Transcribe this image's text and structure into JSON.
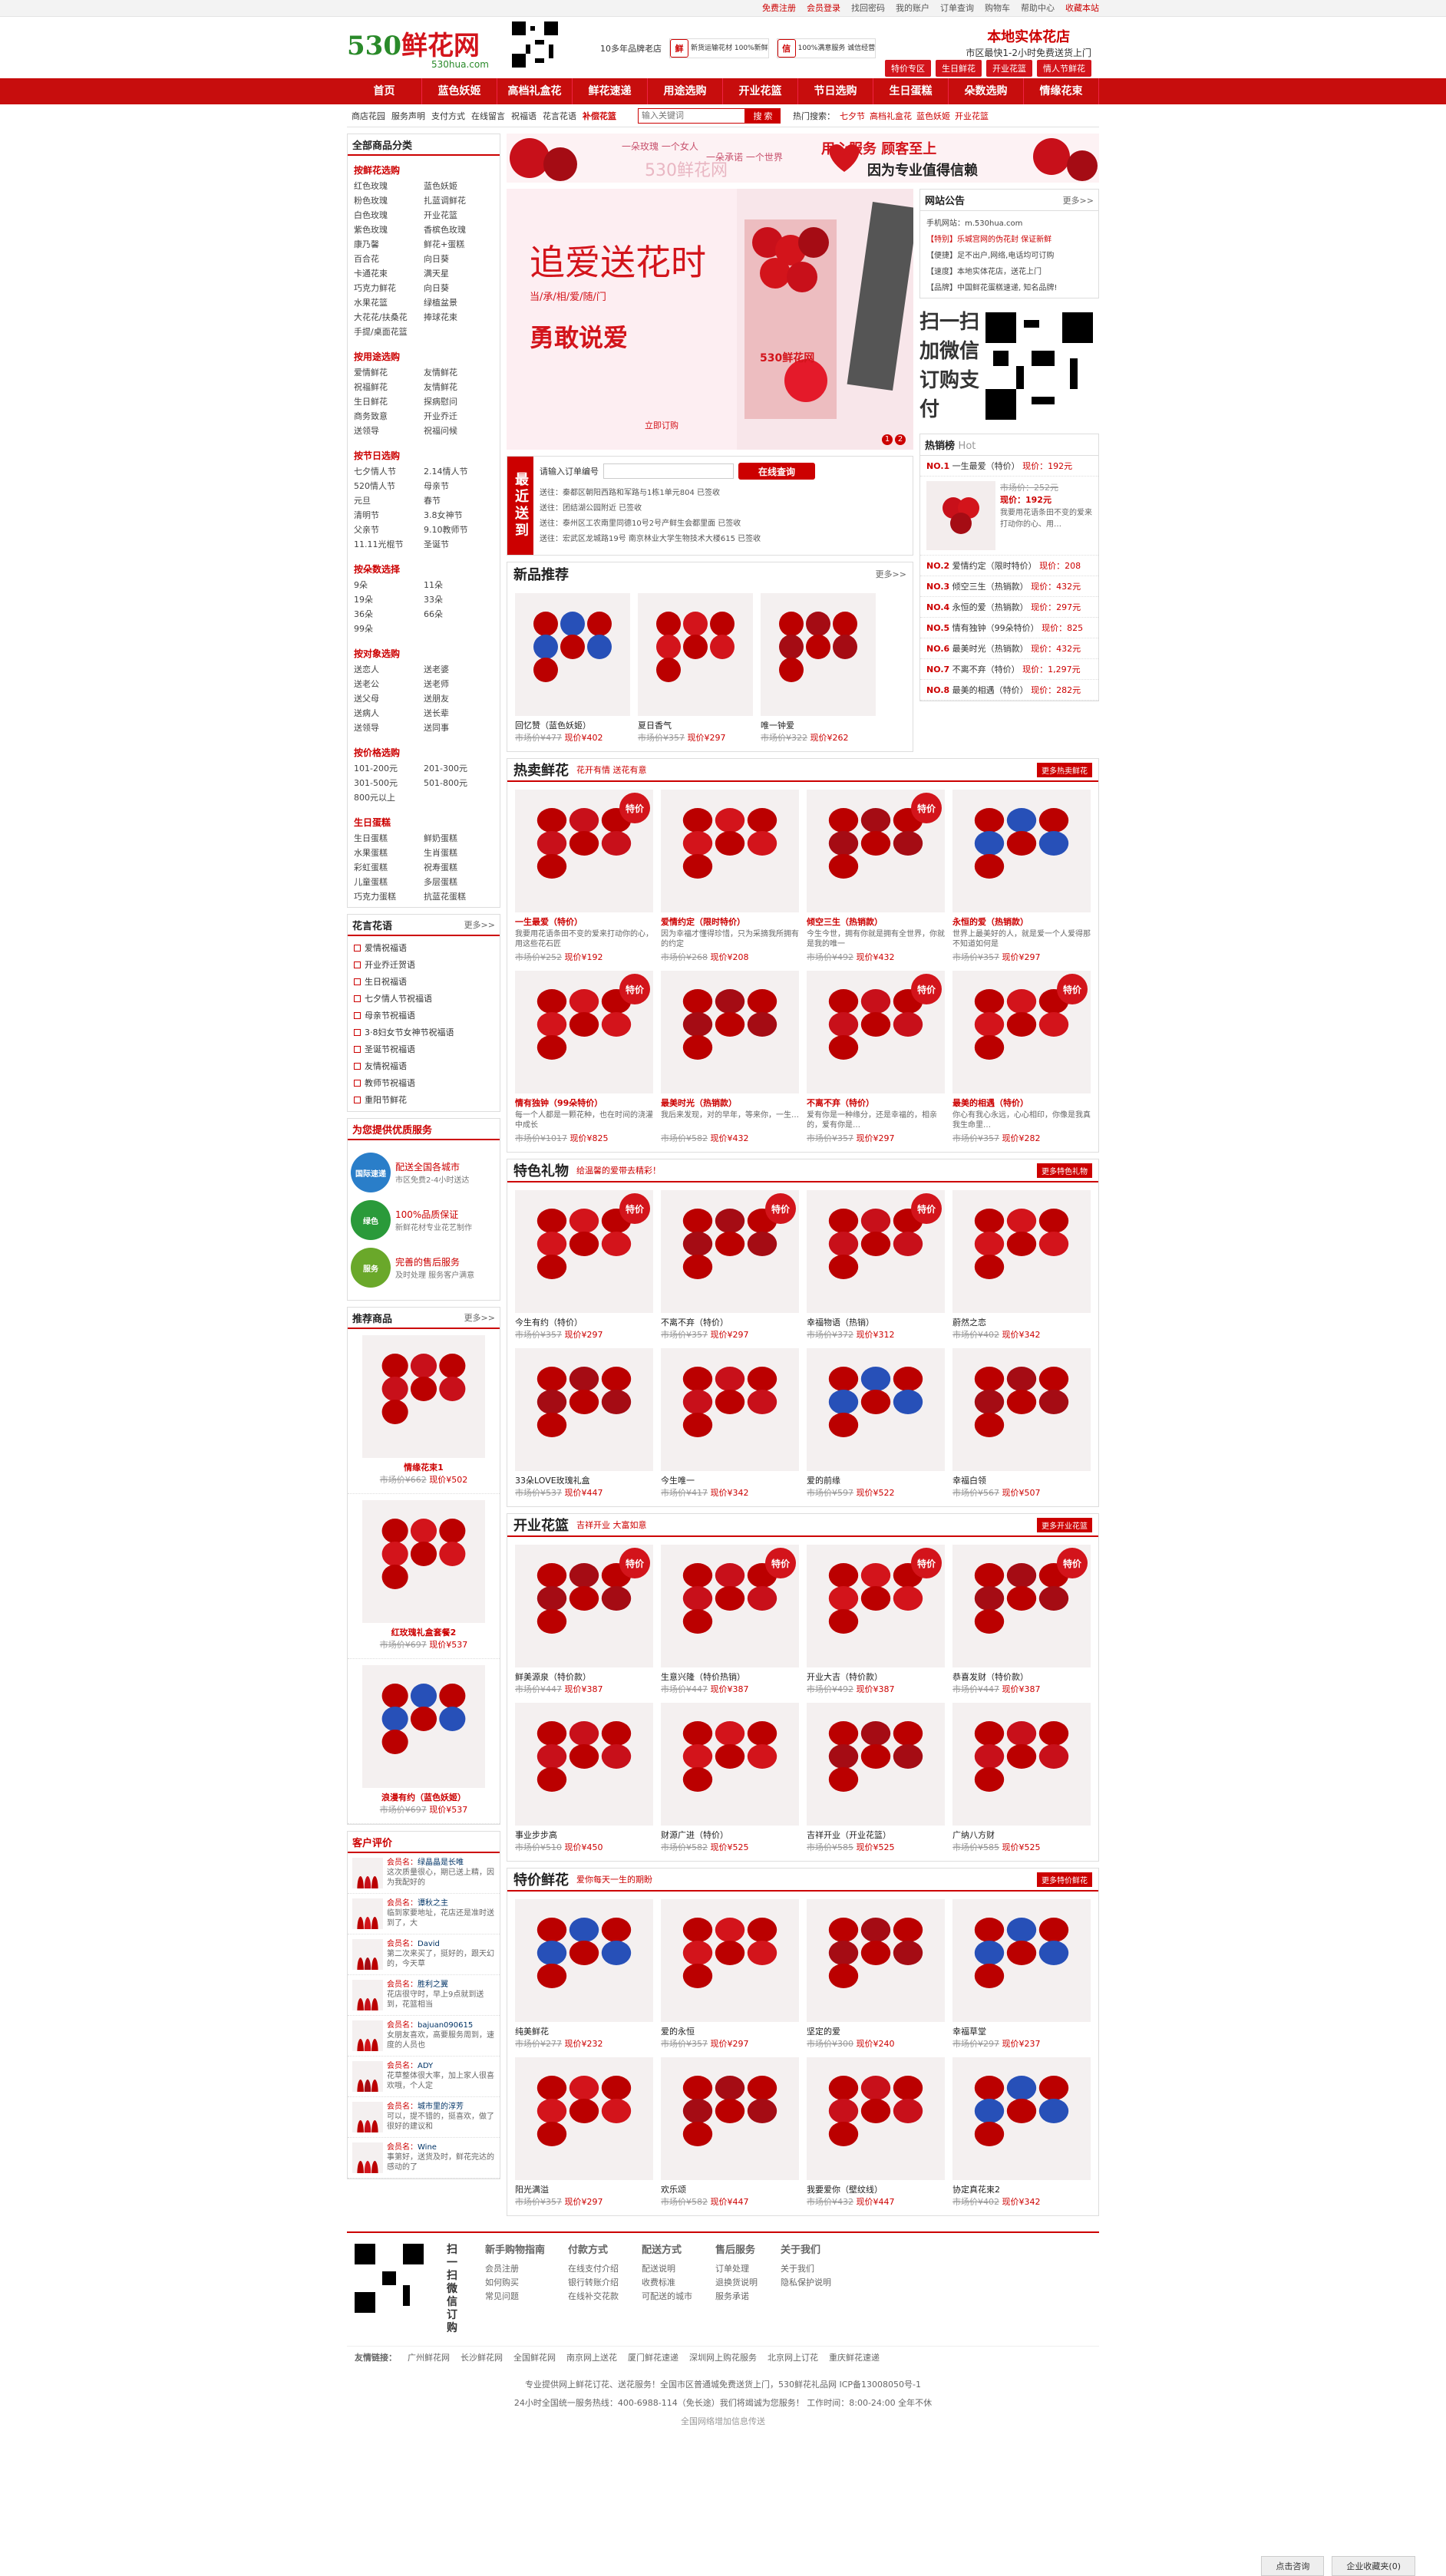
{
  "topbar": {
    "links": [
      "免费注册",
      "会员登录",
      "找回密码",
      "我的账户",
      "订单查询",
      "购物车",
      "帮助中心",
      "收藏本站"
    ]
  },
  "logo": {
    "name_green": "530",
    "name_red": "鲜花网",
    "domain": "530hua.com"
  },
  "header": {
    "promise1": "10多年品牌老店",
    "badge1": "鲜",
    "badge1_text": "新货运输花材 100%新鲜",
    "badge2": "信",
    "badge2_text": "100%满意服务 诚信经营",
    "store_title": "本地实体花店",
    "store_sub": "市区最快1-2小时免费送货上门",
    "btns": [
      "特价专区",
      "生日鲜花",
      "开业花篮",
      "情人节鲜花"
    ]
  },
  "nav": [
    "首页",
    "蓝色妖姬",
    "高档礼盒花",
    "鲜花速递",
    "用途选购",
    "开业花篮",
    "节日选购",
    "生日蛋糕",
    "朵数选购",
    "情缘花束"
  ],
  "subnav": {
    "links": [
      "商店花园",
      "服务声明",
      "支付方式",
      "在线留言",
      "祝福语",
      "花言花语"
    ],
    "special": "补偿花篮",
    "search_placeholder": "输入关键词",
    "search_btn": "搜 索",
    "hot_label": "热门搜索：",
    "hot": [
      "七夕节",
      "高档礼盒花",
      "蓝色妖姬",
      "开业花篮"
    ]
  },
  "cats": {
    "title": "全部商品分类",
    "s1": {
      "t": "按鲜花选购",
      "items": [
        "红色玫瑰",
        "蓝色妖姬",
        "粉色玫瑰",
        "扎蓝调鲜花",
        "白色玫瑰",
        "开业花篮",
        "紫色玫瑰",
        "香槟色玫瑰",
        "康乃馨",
        "鲜花+蛋糕",
        "百合花",
        "向日葵",
        "卡通花束",
        "满天星",
        "巧克力鲜花",
        "向日葵",
        "水果花篮",
        "绿植盆景",
        "大花花/扶桑花",
        "捧球花束",
        "手提/桌面花篮"
      ]
    },
    "s2": {
      "t": "按用途选购",
      "items": [
        "爱情鲜花",
        "友情鲜花",
        "祝福鲜花",
        "友情鲜花",
        "生日鲜花",
        "探病慰问",
        "商务致意",
        "开业乔迁",
        "送领导",
        "祝福问候"
      ]
    },
    "s3": {
      "t": "按节日选购",
      "items": [
        "七夕情人节",
        "2.14情人节",
        "520情人节",
        "母亲节",
        "元旦",
        "春节",
        "清明节",
        "3.8女神节",
        "父亲节",
        "9.10教师节",
        "11.11光棍节",
        "圣诞节"
      ]
    },
    "s4": {
      "t": "按朵数选择",
      "items": [
        "9朵",
        "11朵",
        "19朵",
        "33朵",
        "36朵",
        "66朵",
        "99朵"
      ]
    },
    "s5": {
      "t": "按对象选购",
      "items": [
        "送恋人",
        "送老婆",
        "送老公",
        "送老师",
        "送父母",
        "送朋友",
        "送病人",
        "送长辈",
        "送领导",
        "送同事"
      ]
    },
    "s6": {
      "t": "按价格选购",
      "items": [
        "101-200元",
        "201-300元",
        "301-500元",
        "501-800元",
        "800元以上"
      ]
    },
    "s7": {
      "t": "生日蛋糕",
      "items": [
        "生日蛋糕",
        "鲜奶蛋糕",
        "水果蛋糕",
        "生肖蛋糕",
        "彩虹蛋糕",
        "祝寿蛋糕",
        "儿童蛋糕",
        "多层蛋糕",
        "巧克力蛋糕",
        "抗蓝花蛋糕"
      ]
    }
  },
  "flowerlang": {
    "title": "花言花语",
    "more": "更多>>",
    "items": [
      "爱情祝福语",
      "开业乔迁贺语",
      "生日祝福语",
      "七夕情人节祝福语",
      "母亲节祝福语",
      "3·8妇女节女神节祝福语",
      "圣诞节祝福语",
      "友情祝福语",
      "教师节祝福语",
      "重阳节鲜花"
    ]
  },
  "service": {
    "title": "为您提供优质服务",
    "rows": [
      {
        "icon": "国际速递",
        "a": "配送全国各城市",
        "b": "市区免费2-4小时送达"
      },
      {
        "icon": "绿色",
        "a": "100%品质保证",
        "b": "新鲜花材专业花艺制作"
      },
      {
        "icon": "服务",
        "a": "完善的售后服务",
        "b": "及时处理 服务客户满意"
      }
    ]
  },
  "recommend": {
    "title": "推荐商品",
    "more": "更多>>",
    "items": [
      {
        "name": "情缘花束1",
        "old": "市场价¥662",
        "now": "现价¥502"
      },
      {
        "name": "红玫瑰礼盒套餐2",
        "old": "市场价¥697",
        "now": "现价¥537"
      },
      {
        "name": "浪漫有约（蓝色妖姬）",
        "old": "市场价¥697",
        "now": "现价¥537"
      }
    ]
  },
  "reviews": {
    "title": "客户评价",
    "items": [
      {
        "u": "会员名：",
        "n": "绿晶晶是长唯",
        "t": "这次质量很心，期已送上精，因为我配好的"
      },
      {
        "u": "会员名：",
        "n": "谭秋之主",
        "t": "临到家要地址，花店还是准时送到了，大"
      },
      {
        "u": "会员名：",
        "n": "David",
        "t": "第二次来买了，挺好的，跟天幻的，今天草"
      },
      {
        "u": "会员名：",
        "n": "胜利之翼",
        "t": "花店很守时，早上9点就到送到，花篮相当"
      },
      {
        "u": "会员名：",
        "n": "bajuan090615",
        "t": "女朋友喜欢，高要服务周到，速度的人员也"
      },
      {
        "u": "会员名：",
        "n": "ADY",
        "t": "花草整体很大率，加上家人很喜欢哦，个人定"
      },
      {
        "u": "会员名：",
        "n": "城市里的淳芳",
        "t": "可以，提不错的，挺喜欢，做了很好的建议和"
      },
      {
        "u": "会员名：",
        "n": "Wine",
        "t": "事第好，送货及时，鲜花完达的感动的了"
      }
    ]
  },
  "banner": {
    "t1": "一朵玫瑰 一个女人",
    "t2": "一朵承诺 一个世界",
    "brand": "530鲜花网",
    "slogan1": "用心服务 顾客至上",
    "slogan2": "因为专业值得信赖"
  },
  "slide": {
    "t1": "追爱送花时",
    "t2": "当/承/相/爱/随/门",
    "t3": "勇敢说爱",
    "brand": "530鲜花网",
    "btn": "立即订购",
    "dots": [
      "1",
      "2"
    ]
  },
  "notice": {
    "title": "网站公告",
    "more": "更多>>",
    "items": [
      "手机网站：m.530hua.com",
      "【特别】乐城宫网的伪花封 保证新鲜",
      "【便捷】足不出户,网络,电话均可订购",
      "【速度】本地实体花店，送花上门",
      "【品牌】中国鲜花蛋糕速递, 知名品牌!"
    ]
  },
  "wechat": {
    "t": "扫一扫 加微信 订购支付"
  },
  "query": {
    "label": "最近送到",
    "input_label": "请输入订单编号",
    "btn": "在线查询",
    "logs": [
      "送往：秦都区朝阳西路和军路与1栋1单元804 已签收",
      "送往：团结湖公园附近 已签收",
      "送往：泰州区工农南里同德10号2号产鲜生会都里面 已签收",
      "送往：宏武区龙城路19号 南京林业大学生物技术大楼615 已签收"
    ]
  },
  "ranking": {
    "title": "热销榜",
    "sub": "Hot",
    "first": {
      "no": "NO.1",
      "name": "一生最爱（特价）",
      "price": "现价：192元",
      "old": "市场价：252元",
      "now": "现价：192元",
      "desc": "我要用花语条田不变的爱来打动你的心、用…"
    },
    "items": [
      {
        "no": "NO.2",
        "name": "爱情约定（限时特价）",
        "price": "现价：208"
      },
      {
        "no": "NO.3",
        "name": "倾空三生（热销款）",
        "price": "现价：432元"
      },
      {
        "no": "NO.4",
        "name": "永恒的爱（热销款）",
        "price": "现价：297元"
      },
      {
        "no": "NO.5",
        "name": "情有独钟（99朵特价）",
        "price": "现价：825"
      },
      {
        "no": "NO.6",
        "name": "最美时光（热销款）",
        "price": "现价：432元"
      },
      {
        "no": "NO.7",
        "name": "不离不弃（特价）",
        "price": "现价：1,297元"
      },
      {
        "no": "NO.8",
        "name": "最美的相遇（特价）",
        "price": "现价：282元"
      }
    ]
  },
  "newproducts": {
    "title": "新品推荐",
    "more": "更多>>",
    "items": [
      {
        "name": "回忆赞（蓝色妖姬）",
        "old": "市场价¥477",
        "now": "现价¥402"
      },
      {
        "name": "夏日香气",
        "old": "市场价¥357",
        "now": "现价¥297"
      },
      {
        "name": "唯一钟爱",
        "old": "市场价¥322",
        "now": "现价¥262"
      }
    ]
  },
  "hot": {
    "title": "热卖鲜花",
    "sub": "花开有情 送花有意",
    "more": "更多热卖鲜花",
    "items": [
      {
        "name": "一生最爱（特价）",
        "desc": "我要用花语条田不变的爱来打动你的心，用这些花石匠",
        "old": "市场价¥252",
        "now": "现价¥192",
        "tag": "特价"
      },
      {
        "name": "爱情约定（限时特价）",
        "desc": "因为幸福才懂得珍惜，只为采摘我所拥有的约定",
        "old": "市场价¥268",
        "now": "现价¥208",
        "tag": ""
      },
      {
        "name": "倾空三生（热销款）",
        "desc": "今生今世，拥有你就是拥有全世界，你就是我的唯一",
        "old": "市场价¥492",
        "now": "现价¥432",
        "tag": "特价"
      },
      {
        "name": "永恒的爱（热销款）",
        "desc": "世界上最美好的人，就是爱一个人爱得那不知道如何是",
        "old": "市场价¥357",
        "now": "现价¥297",
        "tag": ""
      },
      {
        "name": "情有独钟（99朵特价）",
        "desc": "每一个人都是一颗花种，也在时间的浇灌中成长",
        "old": "市场价¥1017",
        "now": "现价¥825",
        "tag": "特价"
      },
      {
        "name": "最美时光（热销款）",
        "desc": "我后来发现，对的早年，等来你，一生…",
        "old": "市场价¥582",
        "now": "现价¥432",
        "tag": ""
      },
      {
        "name": "不离不弃（特价）",
        "desc": "爱有你是一种缘分，还是幸福的，相亲的，爱有你是…",
        "old": "市场价¥357",
        "now": "现价¥297",
        "tag": "特价"
      },
      {
        "name": "最美的相遇（特价）",
        "desc": "你心有我心永远，心心相印，你像是我真我生命里…",
        "old": "市场价¥357",
        "now": "现价¥282",
        "tag": "特价"
      }
    ]
  },
  "gift": {
    "title": "特色礼物",
    "sub": "给温馨的爱带去精彩！",
    "more": "更多特色礼物",
    "items": [
      {
        "name": "今生有约（特价）",
        "old": "市场价¥357",
        "now": "现价¥297",
        "tag": "特价"
      },
      {
        "name": "不离不弃（特价）",
        "old": "市场价¥357",
        "now": "现价¥297",
        "tag": "特价"
      },
      {
        "name": "幸福物语（热销）",
        "old": "市场价¥372",
        "now": "现价¥312",
        "tag": "特价"
      },
      {
        "name": "蔚然之恋",
        "old": "市场价¥402",
        "now": "现价¥342",
        "tag": ""
      },
      {
        "name": "33朵LOVE玫瑰礼盒",
        "old": "市场价¥537",
        "now": "现价¥447",
        "tag": ""
      },
      {
        "name": "今生唯一",
        "old": "市场价¥417",
        "now": "现价¥342",
        "tag": ""
      },
      {
        "name": "爱的前缘",
        "old": "市场价¥597",
        "now": "现价¥522",
        "tag": ""
      },
      {
        "name": "幸福白领",
        "old": "市场价¥567",
        "now": "现价¥507",
        "tag": ""
      }
    ]
  },
  "basket": {
    "title": "开业花篮",
    "sub": "吉祥开业 大富如意",
    "more": "更多开业花篮",
    "items": [
      {
        "name": "鲜美源泉（特价款）",
        "old": "市场价¥447",
        "now": "现价¥387",
        "tag": "特价"
      },
      {
        "name": "生意兴隆（特价热销）",
        "old": "市场价¥447",
        "now": "现价¥387",
        "tag": "特价"
      },
      {
        "name": "开业大吉（特价款）",
        "old": "市场价¥492",
        "now": "现价¥387",
        "tag": "特价"
      },
      {
        "name": "恭喜发财（特价款）",
        "old": "市场价¥447",
        "now": "现价¥387",
        "tag": "特价"
      },
      {
        "name": "事业步步高",
        "old": "市场价¥510",
        "now": "现价¥450",
        "tag": ""
      },
      {
        "name": "财源广进（特价）",
        "old": "市场价¥582",
        "now": "现价¥525",
        "tag": ""
      },
      {
        "name": "吉祥开业（开业花篮）",
        "old": "市场价¥585",
        "now": "现价¥525",
        "tag": ""
      },
      {
        "name": "广纳八方财",
        "old": "市场价¥585",
        "now": "现价¥525",
        "tag": ""
      }
    ]
  },
  "special": {
    "title": "特价鲜花",
    "sub": "爱你每天一生的期盼",
    "more": "更多特价鲜花",
    "items": [
      {
        "name": "纯美鲜花",
        "old": "市场价¥277",
        "now": "现价¥232"
      },
      {
        "name": "爱的永恒",
        "old": "市场价¥357",
        "now": "现价¥297"
      },
      {
        "name": "坚定的爱",
        "old": "市场价¥300",
        "now": "现价¥240"
      },
      {
        "name": "幸福草堂",
        "old": "市场价¥297",
        "now": "现价¥237"
      },
      {
        "name": "阳光满溢",
        "old": "市场价¥357",
        "now": "现价¥297"
      },
      {
        "name": "欢乐颂",
        "old": "市场价¥582",
        "now": "现价¥447"
      },
      {
        "name": "我要爱你（壁纹线）",
        "old": "市场价¥432",
        "now": "现价¥447"
      },
      {
        "name": "协定真花束2",
        "old": "市场价¥402",
        "now": "现价¥342"
      }
    ]
  },
  "footer": {
    "scan": "扫一扫微信订购",
    "cols": [
      {
        "h": "新手购物指南",
        "items": [
          "会员注册",
          "如何购买",
          "常见问题"
        ]
      },
      {
        "h": "付款方式",
        "items": [
          "在线支付介绍",
          "银行转账介绍",
          "在线补交花款"
        ]
      },
      {
        "h": "配送方式",
        "items": [
          "配送说明",
          "收费标准",
          "可配送的城市"
        ]
      },
      {
        "h": "售后服务",
        "items": [
          "订单处理",
          "退换货说明",
          "服务承诺"
        ]
      },
      {
        "h": "关于我们",
        "items": [
          "关于我们",
          "隐私保护说明"
        ]
      }
    ],
    "links_label": "友情链接：",
    "links": [
      "广州鲜花网",
      "长沙鲜花网",
      "全国鲜花网",
      "南京网上送花",
      "厦门鲜花速递",
      "深圳网上购花服务",
      "北京网上订花",
      "重庆鲜花速递"
    ],
    "copy1": "专业提供网上鲜花订花、送花服务！全国市区普通城免费送货上门，530鲜花礼品网   ICP备13008050号-1",
    "copy2": "24小时全国统一服务热线：400-6988-114（免长途）我们将竭诚为您服务！ 工作时间：8:00-24:00 全年不休",
    "copy3": "全国网络增加信息传送"
  },
  "chat": {
    "a": "点击咨询",
    "b": "企业收藏夹(0)"
  }
}
